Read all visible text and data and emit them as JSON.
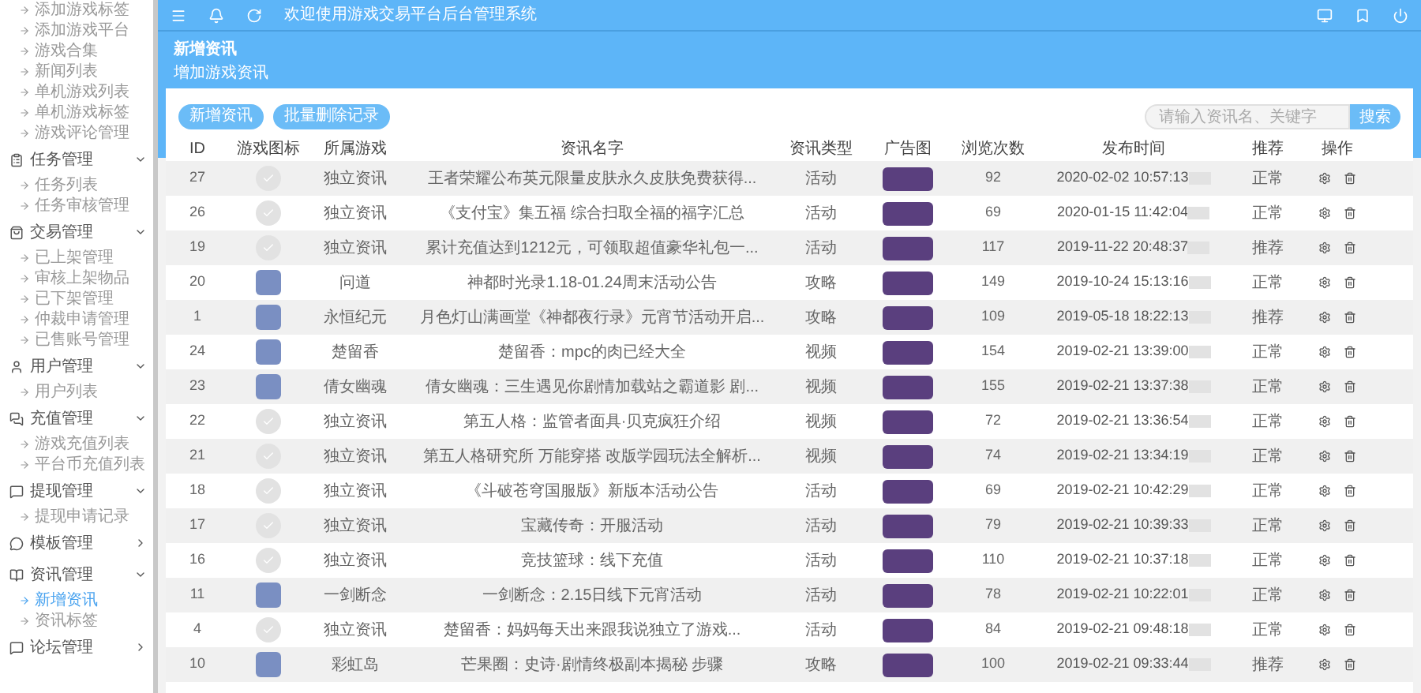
{
  "top_bar": {
    "notice": "欢迎使用游戏交易平台后台管理系统"
  },
  "sidebar": {
    "groups": [
      {
        "children": [
          {
            "label": "添加游戏标签",
            "selected": false
          },
          {
            "label": "添加游戏平台",
            "selected": false
          },
          {
            "label": "游戏合集",
            "selected": false
          },
          {
            "label": "新闻列表",
            "selected": false
          },
          {
            "label": "单机游戏列表",
            "selected": false
          },
          {
            "label": "单机游戏标签",
            "selected": false
          },
          {
            "label": "游戏评论管理",
            "selected": false
          }
        ]
      },
      {
        "label": "任务管理",
        "expanded": true,
        "children": [
          {
            "label": "任务列表",
            "selected": false
          },
          {
            "label": "任务审核管理",
            "selected": false
          }
        ]
      },
      {
        "label": "交易管理",
        "expanded": true,
        "children": [
          {
            "label": "已上架管理",
            "selected": false
          },
          {
            "label": "审核上架物品",
            "selected": false
          },
          {
            "label": "已下架管理",
            "selected": false
          },
          {
            "label": "仲裁申请管理",
            "selected": false
          },
          {
            "label": "已售账号管理",
            "selected": false
          }
        ]
      },
      {
        "label": "用户管理",
        "expanded": true,
        "children": [
          {
            "label": "用户列表",
            "selected": false
          }
        ]
      },
      {
        "label": "充值管理",
        "expanded": true,
        "children": [
          {
            "label": "游戏充值列表",
            "selected": false
          },
          {
            "label": "平台币充值列表",
            "selected": false
          }
        ]
      },
      {
        "label": "提现管理",
        "expanded": true,
        "children": [
          {
            "label": "提现申请记录",
            "selected": false
          }
        ]
      },
      {
        "label": "模板管理",
        "expanded": false
      },
      {
        "label": "资讯管理",
        "expanded": true,
        "children": [
          {
            "label": "新增资讯",
            "selected": true
          },
          {
            "label": "资讯标签",
            "selected": false
          }
        ]
      },
      {
        "label": "论坛管理",
        "expanded": false
      }
    ]
  },
  "page_header": {
    "title": "新增资讯",
    "subtitle": "增加游戏资讯"
  },
  "toolbar": {
    "buttons": [
      "新增资讯",
      "批量删除记录"
    ],
    "search": {
      "placeholder": "请输入资讯名、关键字",
      "button": "搜索"
    }
  },
  "table": {
    "columns": [
      "ID",
      "游戏图标",
      "所属游戏",
      "资讯名字",
      "资讯类型",
      "广告图",
      "浏览次数",
      "发布时间",
      "推荐",
      "操作"
    ],
    "rows": [
      {
        "id": "27",
        "kind": "blank",
        "game": "独立资讯",
        "name": "王者荣耀公布英元限量皮肤永久皮肤免费获得...",
        "type": "活动",
        "views": "92",
        "time": "2020-02-02 10:57:13",
        "recommend": "正常"
      },
      {
        "id": "26",
        "kind": "blank",
        "game": "独立资讯",
        "name": "《支付宝》集五福 综合扫取全福的福字汇总",
        "type": "活动",
        "views": "69",
        "time": "2020-01-15 11:42:04",
        "recommend": "正常"
      },
      {
        "id": "19",
        "kind": "blank",
        "game": "独立资讯",
        "name": "累计充值达到1212元，可领取超值豪华礼包一...",
        "type": "活动",
        "views": "117",
        "time": "2019-11-22 20:48:37",
        "recommend": "推荐"
      },
      {
        "id": "20",
        "kind": "photo",
        "game": "问道",
        "name": "神都时光录1.18-01.24周末活动公告",
        "type": "攻略",
        "views": "149",
        "time": "2019-10-24 15:13:16",
        "recommend": "正常"
      },
      {
        "id": "1",
        "kind": "photo",
        "game": "永恒纪元",
        "name": "月色灯山满画堂《神都夜行录》元宵节活动开启...",
        "type": "攻略",
        "views": "109",
        "time": "2019-05-18 18:22:13",
        "recommend": "推荐"
      },
      {
        "id": "24",
        "kind": "photo",
        "game": "楚留香",
        "name": "楚留香：mpc的肉已经大全",
        "type": "视频",
        "views": "154",
        "time": "2019-02-21 13:39:00",
        "recommend": "正常"
      },
      {
        "id": "23",
        "kind": "photo",
        "game": "倩女幽魂",
        "name": "倩女幽魂：三生遇见你剧情加载站之霸道影 剧...",
        "type": "视频",
        "views": "155",
        "time": "2019-02-21 13:37:38",
        "recommend": "正常"
      },
      {
        "id": "22",
        "kind": "blank",
        "game": "独立资讯",
        "name": "第五人格：监管者面具·贝克疯狂介绍",
        "type": "视频",
        "views": "72",
        "time": "2019-02-21 13:36:54",
        "recommend": "正常"
      },
      {
        "id": "21",
        "kind": "blank",
        "game": "独立资讯",
        "name": "第五人格研究所 万能穿搭 改版学园玩法全解析...",
        "type": "视频",
        "views": "74",
        "time": "2019-02-21 13:34:19",
        "recommend": "正常"
      },
      {
        "id": "18",
        "kind": "blank",
        "game": "独立资讯",
        "name": "《斗破苍穹国服版》新版本活动公告",
        "type": "活动",
        "views": "69",
        "time": "2019-02-21 10:42:29",
        "recommend": "正常"
      },
      {
        "id": "17",
        "kind": "blank",
        "game": "独立资讯",
        "name": "宝藏传奇：开服活动",
        "type": "活动",
        "views": "79",
        "time": "2019-02-21 10:39:33",
        "recommend": "正常"
      },
      {
        "id": "16",
        "kind": "blank",
        "game": "独立资讯",
        "name": "竞技篮球：线下充值",
        "type": "活动",
        "views": "110",
        "time": "2019-02-21 10:37:18",
        "recommend": "正常"
      },
      {
        "id": "11",
        "kind": "photo",
        "game": "一剑断念",
        "name": "一剑断念：2.15日线下元宵活动",
        "type": "活动",
        "views": "78",
        "time": "2019-02-21 10:22:01",
        "recommend": "正常"
      },
      {
        "id": "4",
        "kind": "blank",
        "game": "独立资讯",
        "name": "楚留香：妈妈每天出来跟我说独立了游戏...",
        "type": "活动",
        "views": "84",
        "time": "2019-02-21 09:48:18",
        "recommend": "正常"
      },
      {
        "id": "10",
        "kind": "photo",
        "game": "彩虹岛",
        "name": "芒果圈：史诗·剧情终极副本揭秘 步骤",
        "type": "攻略",
        "views": "100",
        "time": "2019-02-21 09:33:44",
        "recommend": "推荐"
      }
    ]
  }
}
